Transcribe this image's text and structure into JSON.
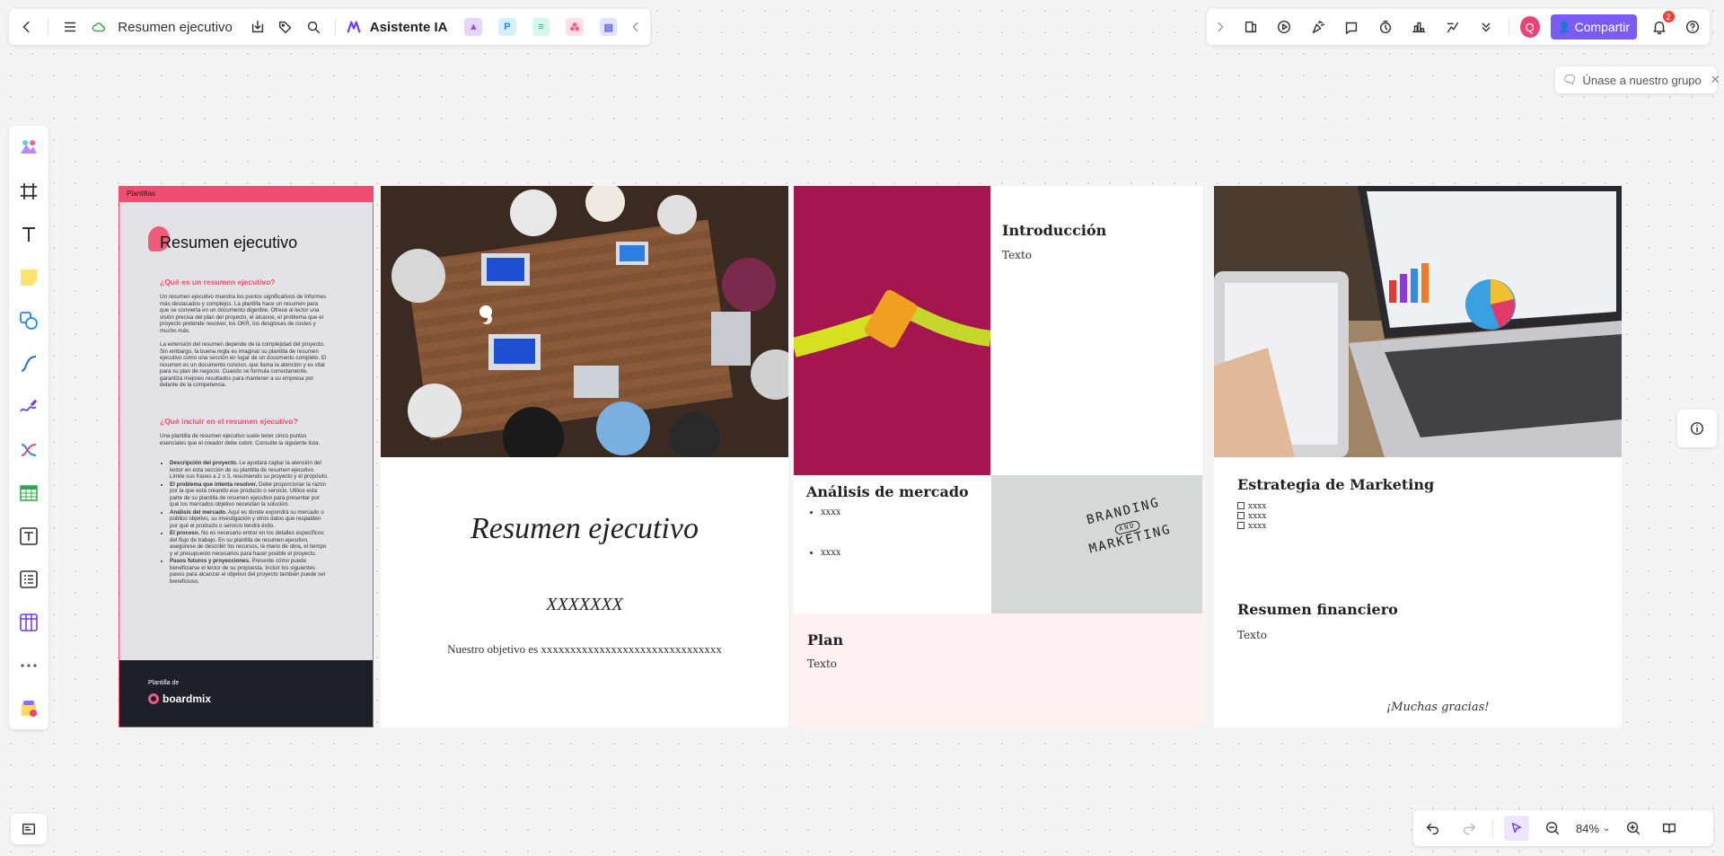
{
  "toolbar_left": {
    "document_title": "Resumen ejecutivo",
    "ai_assistant_label": "Asistente IA"
  },
  "toolbar_right": {
    "avatar_initial": "Q",
    "share_label": "Compartir",
    "notification_count": "2"
  },
  "join_group": {
    "label": "Únase a nuestro grupo"
  },
  "zoom": {
    "level": "84%"
  },
  "doc_board": {
    "header_tag": "Plantillas",
    "title": "Resumen ejecutivo",
    "q1": "¿Qué es un resumen ejecutivo?",
    "p1": "Un resumen ejecutivo muestra los puntos significativos de Informes más destacados y complejos. La plantilla hace un resumen para que se convierta en un documento digerible. Ofrece al lector una visión precisa del plan del proyecto, el alcance, el problema que el proyecto pretende resolver, los OKR, los desglosas de costes y mucho más.",
    "p2": "La extensión del resumen depende de la complejidad del proyecto. Sin embargo, la buena regla es imaginar su plantilla de resumen ejecutivo como una sección en lugar de un documento completo. El resumen es un documento conciso, que llama la atención y es vital para su plan de negocio. Cuando se formula correctamente, garantiza mejores resultados para mantener a su empresa por delante de la competencia.",
    "q2": "¿Qué incluir en el resumen ejecutivo?",
    "p3": "Una plantilla de resumen ejecutivo suele tener cinco puntos esenciales que el creador debe cubrir. Consulte la siguiente lista.",
    "bullets": [
      {
        "bold": "Descripción del proyecto.",
        "text": " Le ayudará captar la atención del lector en esta sección de su plantilla de resumen ejecutivo. Limite sus frases a 2 o 3, resumiendo su proyecto y el propósito."
      },
      {
        "bold": "El problema que intenta resolver.",
        "text": " Debe proporcionar la razón por la que está creando ese producto o servicio. Utilice esta parte de su plantilla de resumen ejecutivo para presentar por qué los mercados objetivo necesitan la solución."
      },
      {
        "bold": "Análisis del mercado.",
        "text": " Aquí es donde expondrá su mercado o público objetivo, su investigación y otros datos que respalden por qué el producto o servicio tendrá éxito."
      },
      {
        "bold": "El proceso.",
        "text": " No es necesario entrar en los detalles específicos del flujo de trabajo. En su plantilla de resumen ejecutivo, asegúrese de describir los recursos, la mano de obra, el tiempo y el presupuesto necesarios para hacer posible el proyecto."
      },
      {
        "bold": "Pasos futuros y proyecciones.",
        "text": " Presente cómo puede beneficiarse el lector de su propuesta. Incluir los siguientes pasos para alcanzar el objetivo del proyecto también puede ser beneficioso."
      }
    ],
    "footer_label": "Plantilla de",
    "footer_brand": "boardmix"
  },
  "slide1": {
    "title": "Resumen ejecutivo",
    "placeholder": "XXXXXXX",
    "objective": "Nuestro objetivo es xxxxxxxxxxxxxxxxxxxxxxxxxxxxxxx"
  },
  "slide2": {
    "intro_title": "Introducción",
    "intro_text": "Texto",
    "market_title": "Análisis de mercado",
    "market_items": [
      "xxxx",
      "xxxx"
    ],
    "branding_line1": "BRANDING",
    "branding_and": "AND",
    "branding_line2": "MARKETING",
    "plan_title": "Plan",
    "plan_text": "Texto"
  },
  "slide3": {
    "strategy_title": "Estrategia de Marketing",
    "strategy_items": [
      "xxxx",
      "xxxx",
      "xxxx"
    ],
    "finance_title": "Resumen financiero",
    "finance_text": "Texto",
    "thanks": "¡Muchas gracias!"
  },
  "colors": {
    "accent_pink": "#f14e6f",
    "share_purple": "#7a5cf5",
    "plan_bg": "#fff1f3",
    "magenta_photo": "#a3174e"
  }
}
